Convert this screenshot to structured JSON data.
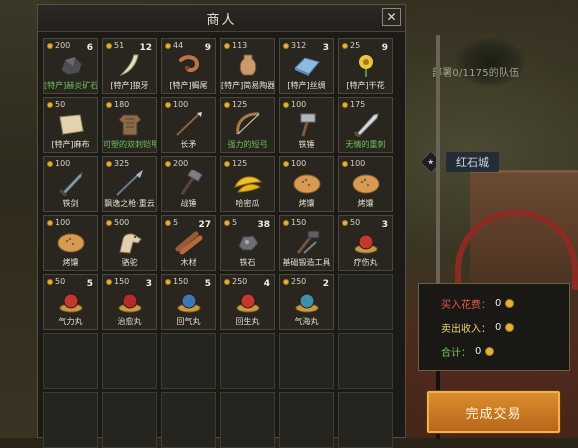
{
  "window": {
    "title": "商人",
    "close_label": "✕"
  },
  "items": [
    {
      "price": "200",
      "qty": "6",
      "name": "[特产]赫炎矿石",
      "icon": "ore-icon",
      "color": "green"
    },
    {
      "price": "51",
      "qty": "12",
      "name": "[特产]狼牙",
      "icon": "wolf-fang-icon",
      "color": "normal"
    },
    {
      "price": "44",
      "qty": "9",
      "name": "[特产]蝎尾",
      "icon": "scorpion-tail-icon",
      "color": "normal"
    },
    {
      "price": "113",
      "qty": "",
      "name": "[特产]简易陶器",
      "icon": "pottery-icon",
      "color": "normal"
    },
    {
      "price": "312",
      "qty": "3",
      "name": "[特产]丝绸",
      "icon": "silk-icon",
      "color": "normal"
    },
    {
      "price": "25",
      "qty": "9",
      "name": "[特产]干花",
      "icon": "dried-flower-icon",
      "color": "normal"
    },
    {
      "price": "50",
      "qty": "",
      "name": "[特产]麻布",
      "icon": "linen-icon",
      "color": "normal"
    },
    {
      "price": "180",
      "qty": "",
      "name": "可塑的双刺铠甲",
      "icon": "armor-icon",
      "color": "green"
    },
    {
      "price": "100",
      "qty": "",
      "name": "长矛",
      "icon": "spear-icon",
      "color": "normal"
    },
    {
      "price": "125",
      "qty": "",
      "name": "强力的短弓",
      "icon": "bow-icon",
      "color": "green"
    },
    {
      "price": "100",
      "qty": "",
      "name": "铁锤",
      "icon": "hammer-icon",
      "color": "normal"
    },
    {
      "price": "175",
      "qty": "",
      "name": "无情的重刺",
      "icon": "heavy-blade-icon",
      "color": "green"
    },
    {
      "price": "100",
      "qty": "",
      "name": "铁剑",
      "icon": "sword-icon",
      "color": "normal"
    },
    {
      "price": "325",
      "qty": "",
      "name": "飘逸之枪·重云",
      "icon": "lance-icon",
      "color": "normal"
    },
    {
      "price": "200",
      "qty": "",
      "name": "战锤",
      "icon": "warhammer-icon",
      "color": "normal"
    },
    {
      "price": "125",
      "qty": "",
      "name": "哈密瓜",
      "icon": "melon-icon",
      "color": "normal"
    },
    {
      "price": "100",
      "qty": "",
      "name": "烤馕",
      "icon": "flatbread-icon",
      "color": "normal"
    },
    {
      "price": "100",
      "qty": "",
      "name": "烤馕",
      "icon": "flatbread-icon",
      "color": "normal"
    },
    {
      "price": "100",
      "qty": "",
      "name": "烤馕",
      "icon": "flatbread-icon",
      "color": "normal"
    },
    {
      "price": "500",
      "qty": "",
      "name": "骆驼",
      "icon": "camel-icon",
      "color": "normal"
    },
    {
      "price": "5",
      "qty": "27",
      "name": "木材",
      "icon": "wood-icon",
      "color": "normal"
    },
    {
      "price": "5",
      "qty": "38",
      "name": "铁石",
      "icon": "iron-ore-icon",
      "color": "normal"
    },
    {
      "price": "150",
      "qty": "",
      "name": "基础锻造工具",
      "icon": "forge-tools-icon",
      "color": "normal"
    },
    {
      "price": "50",
      "qty": "3",
      "name": "疗伤丸",
      "icon": "pill-icon",
      "color": "normal"
    },
    {
      "price": "50",
      "qty": "5",
      "name": "气力丸",
      "icon": "pill-icon",
      "color": "normal"
    },
    {
      "price": "150",
      "qty": "3",
      "name": "治愈丸",
      "icon": "pill-icon",
      "color": "normal"
    },
    {
      "price": "150",
      "qty": "5",
      "name": "回气丸",
      "icon": "pill-icon",
      "color": "normal"
    },
    {
      "price": "250",
      "qty": "4",
      "name": "回生丸",
      "icon": "pill-icon",
      "color": "normal"
    },
    {
      "price": "250",
      "qty": "2",
      "name": "气海丸",
      "icon": "pill-icon",
      "color": "normal"
    }
  ],
  "empty_slots": 13,
  "map": {
    "troop_label": "部署0/1175的队伍",
    "city_name": "红石城",
    "city_emblem": "★"
  },
  "summary": {
    "buy_label": "买入花费：",
    "buy_value": "0",
    "sell_label": "卖出收入：",
    "sell_value": "0",
    "total_label": "合计：",
    "total_value": "0"
  },
  "complete_button": "完成交易",
  "colors": {
    "buy": "#e35a4a",
    "sell": "#e6d36a",
    "total": "#6fc85a",
    "accent": "#d98e2c"
  }
}
